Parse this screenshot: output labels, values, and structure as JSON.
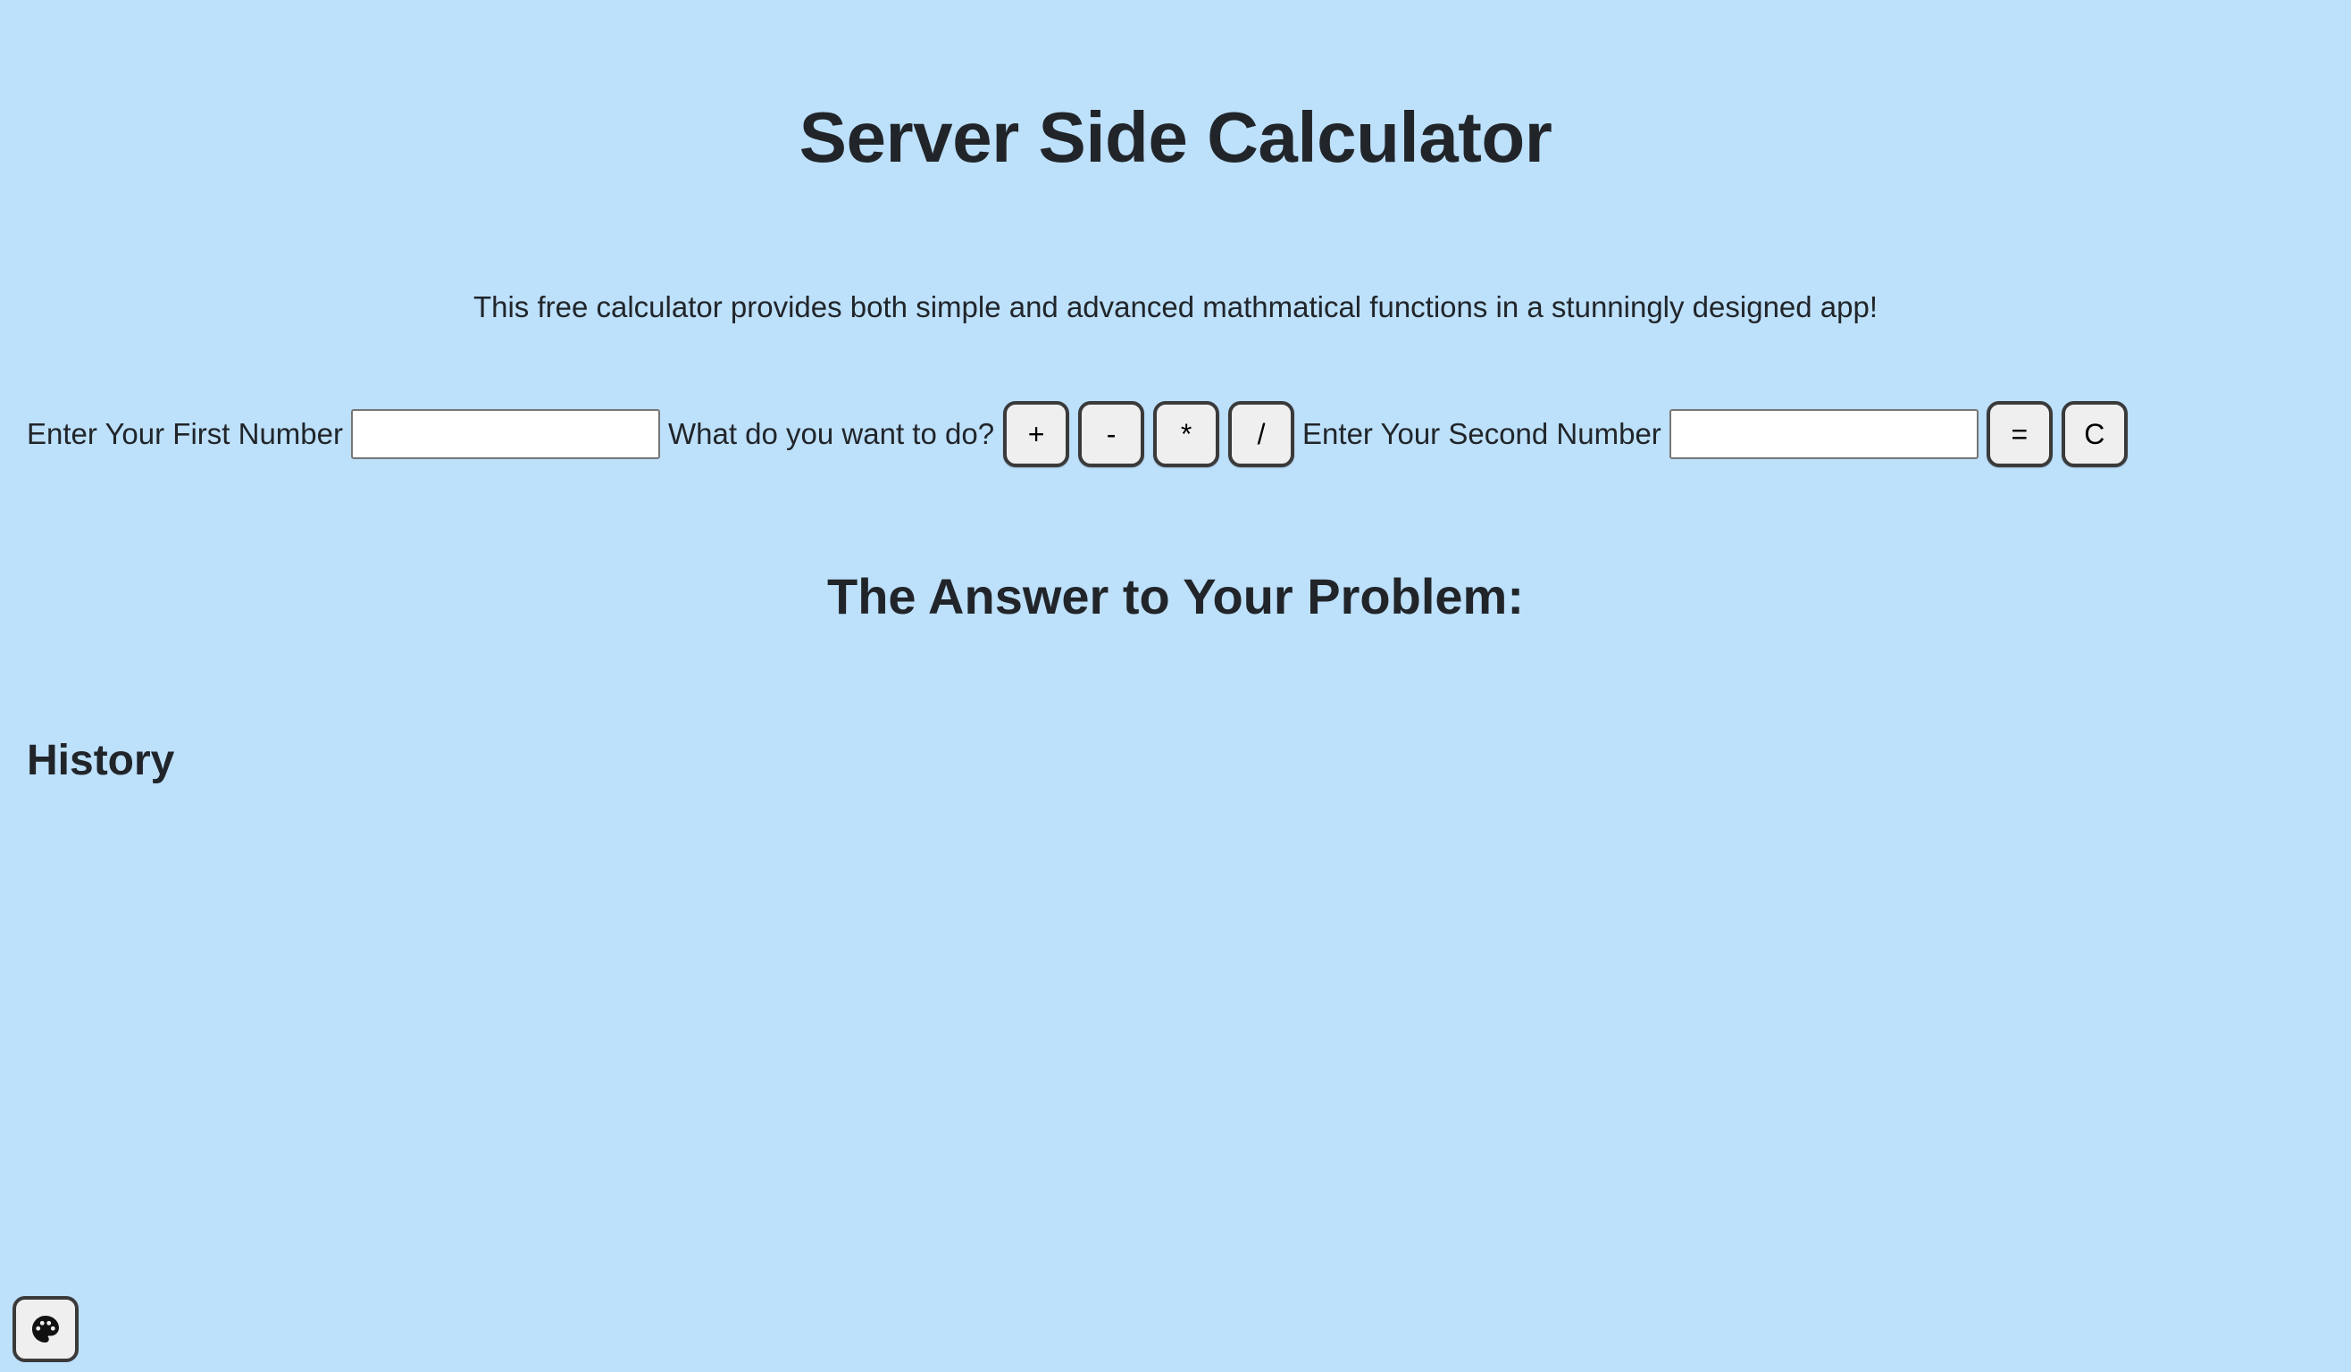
{
  "header": {
    "title": "Server Side Calculator",
    "subtitle": "This free calculator provides both simple and advanced mathmatical functions in a stunningly designed app!"
  },
  "calculator": {
    "first_number_label": "Enter Your First Number",
    "first_number_value": "",
    "first_number_placeholder": "",
    "operation_label": "What do you want to do?",
    "operators": {
      "add": "+",
      "subtract": "-",
      "multiply": "*",
      "divide": "/"
    },
    "second_number_label": "Enter Your Second Number",
    "second_number_value": "",
    "second_number_placeholder": "",
    "equals_label": "=",
    "clear_label": "C"
  },
  "answer": {
    "heading": "The Answer to Your Problem:",
    "value": ""
  },
  "history": {
    "heading": "History",
    "items": []
  },
  "theme_toggle": {
    "icon": "palette-icon"
  },
  "colors": {
    "background": "#bde0fb",
    "text": "#212529",
    "button_background": "#efefef",
    "button_border": "#3a3a3a"
  }
}
